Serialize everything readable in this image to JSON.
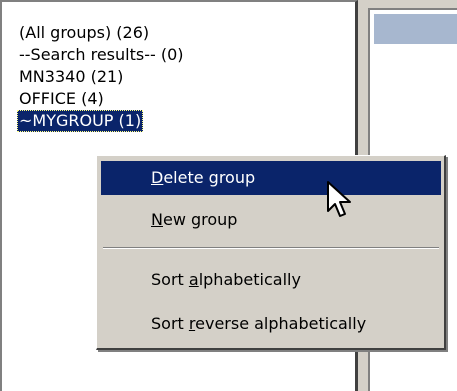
{
  "groups": {
    "items": [
      {
        "label": "(All groups) (26)"
      },
      {
        "label": "--Search results-- (0)"
      },
      {
        "label": "MN3340 (21)"
      },
      {
        "label": "OFFICE (4)"
      },
      {
        "label": "~MYGROUP (1)"
      }
    ],
    "selected_index": 4
  },
  "context_menu": {
    "delete_group": {
      "prefix": "",
      "accel": "D",
      "rest": "elete group"
    },
    "new_group": {
      "prefix": "",
      "accel": "N",
      "rest": "ew group"
    },
    "sort_alpha": {
      "prefix": "Sort ",
      "accel": "a",
      "rest": "lphabetically"
    },
    "sort_reverse": {
      "prefix": "Sort ",
      "accel": "r",
      "rest": "everse alphabetically"
    },
    "highlighted_item": "delete_group"
  },
  "colors": {
    "selection": "#0a246a",
    "menu_background": "#d4d0c8",
    "header_accent": "#a7b7cf"
  },
  "icons": {
    "cursor": "arrow-pointer-icon"
  }
}
